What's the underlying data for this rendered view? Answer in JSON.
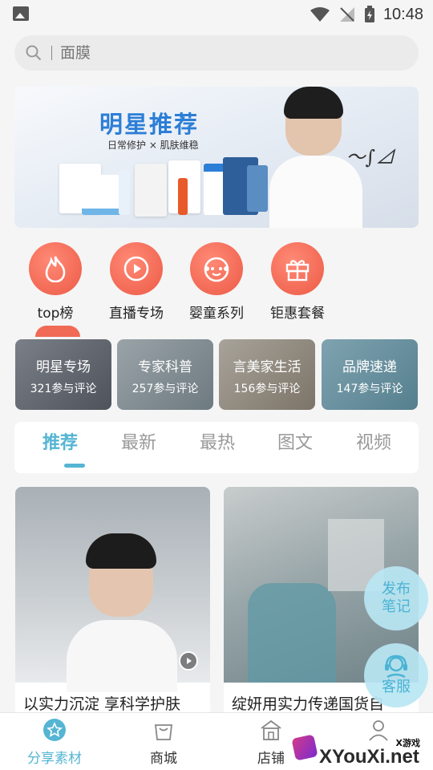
{
  "status_bar": {
    "time": "10:48"
  },
  "search": {
    "placeholder": "面膜"
  },
  "banner": {
    "title": "明星推荐",
    "subtitle": "日常修护 × 肌肤维稳"
  },
  "categories": [
    {
      "label": "top榜",
      "icon": "flame-icon"
    },
    {
      "label": "直播专场",
      "icon": "play-icon"
    },
    {
      "label": "婴童系列",
      "icon": "baby-face-icon"
    },
    {
      "label": "钜惠套餐",
      "icon": "gift-icon"
    }
  ],
  "topic_cards": [
    {
      "title": "明星专场",
      "count": "321参与评论"
    },
    {
      "title": "专家科普",
      "count": "257参与评论"
    },
    {
      "title": "言美家生活",
      "count": "156参与评论"
    },
    {
      "title": "品牌速递",
      "count": "147参与评论"
    }
  ],
  "tabs": [
    {
      "label": "推荐",
      "active": true
    },
    {
      "label": "最新"
    },
    {
      "label": "最热"
    },
    {
      "label": "图文"
    },
    {
      "label": "视频"
    }
  ],
  "posts": [
    {
      "title": "以实力沉淀 享科学护肤",
      "has_video": true
    },
    {
      "title": "绽妍用实力传递国货自"
    }
  ],
  "floating": {
    "publish_line1": "发布",
    "publish_line2": "笔记",
    "service": "客服"
  },
  "bottom_nav": [
    {
      "label": "分享素材",
      "icon": "star-circle-icon",
      "active": true
    },
    {
      "label": "商城",
      "icon": "shopping-bag-icon"
    },
    {
      "label": "店铺",
      "icon": "store-icon"
    },
    {
      "label": "",
      "icon": "user-icon"
    }
  ],
  "watermark": {
    "small": "X游戏",
    "big": "XYouXi.net"
  },
  "colors": {
    "accent": "#55b5d3",
    "category_red": "#ec5a45",
    "banner_blue": "#2c7ed6"
  }
}
